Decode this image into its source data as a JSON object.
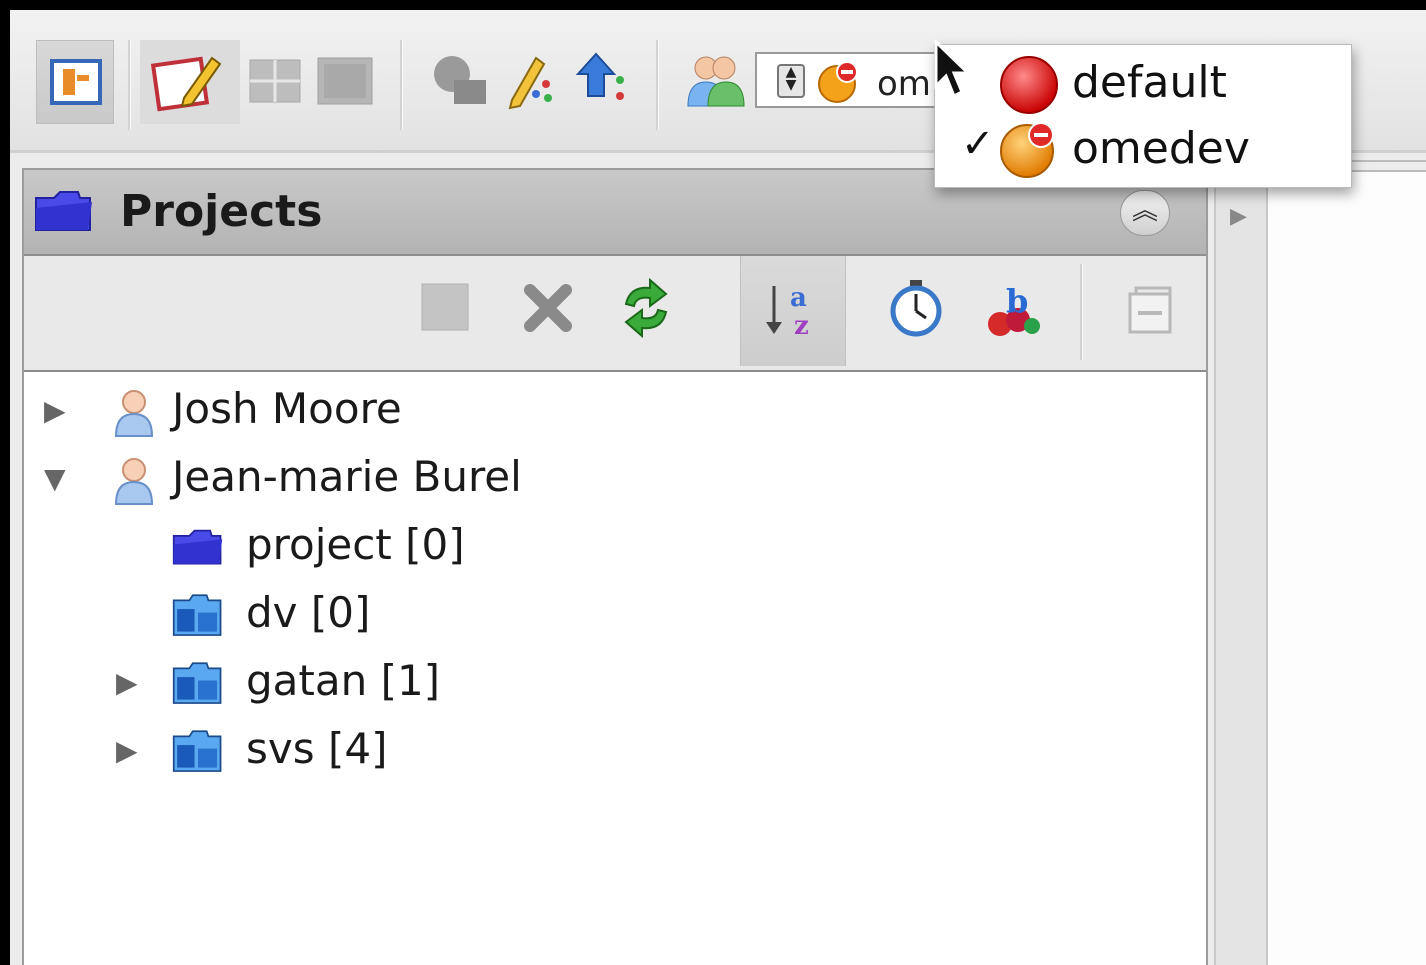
{
  "toolbar": {
    "buttons": [
      {
        "name": "data-manager-button",
        "icon": "data-manager-icon"
      },
      {
        "name": "editor-button",
        "icon": "edit-icon"
      },
      {
        "name": "split-view-button",
        "icon": "split-view-icon"
      },
      {
        "name": "single-view-button",
        "icon": "single-view-icon"
      },
      {
        "name": "search-button",
        "icon": "search-icon"
      },
      {
        "name": "annotate-button",
        "icon": "pencil-icon"
      },
      {
        "name": "import-button",
        "icon": "import-icon"
      }
    ],
    "group_selector": {
      "icon": "users-icon",
      "selected_icon": "group-omedev-icon",
      "value": "om"
    }
  },
  "group_dropdown": {
    "items": [
      {
        "label": "default",
        "icon": "red-group-icon",
        "checked": false
      },
      {
        "label": "omedev",
        "icon": "orange-group-icon",
        "checked": true
      }
    ],
    "check_glyph": "✓"
  },
  "panel": {
    "title": "Projects",
    "title_icon": "projects-folder-icon",
    "collapse_icon": "collapse-up-icon",
    "collapse_glyph": "︽",
    "toolbar": [
      {
        "name": "new-button",
        "icon": "new-item-icon"
      },
      {
        "name": "delete-button",
        "icon": "delete-x-icon"
      },
      {
        "name": "refresh-button",
        "icon": "refresh-icon"
      },
      {
        "name": "sort-alpha-button",
        "icon": "sort-alphabetical-icon"
      },
      {
        "name": "sort-date-button",
        "icon": "stopwatch-icon"
      },
      {
        "name": "tags-button",
        "icon": "tags-icon"
      },
      {
        "name": "collapse-all-button",
        "icon": "collapse-all-icon"
      }
    ]
  },
  "tree": [
    {
      "label": "Josh Moore",
      "icon": "user-icon",
      "expander": "▶",
      "level": 0
    },
    {
      "label": "Jean-marie Burel",
      "icon": "user-icon",
      "expander": "▼",
      "level": 0
    },
    {
      "label": "project [0]",
      "icon": "project-folder-icon",
      "expander": "",
      "level": 1
    },
    {
      "label": "dv [0]",
      "icon": "dataset-folder-icon",
      "expander": "",
      "level": 1
    },
    {
      "label": "gatan [1]",
      "icon": "dataset-folder-icon",
      "expander": "▶",
      "level": 1
    },
    {
      "label": "svs [4]",
      "icon": "dataset-folder-icon",
      "expander": "▶",
      "level": 1
    }
  ],
  "side_strip": {
    "arrow": "▶"
  },
  "colors": {
    "selection_bg": "#cfcfcf",
    "header_bg": "#bcbcbc",
    "dataset_blue": "#2f7fd4",
    "project_purple": "#3a3ad8"
  }
}
